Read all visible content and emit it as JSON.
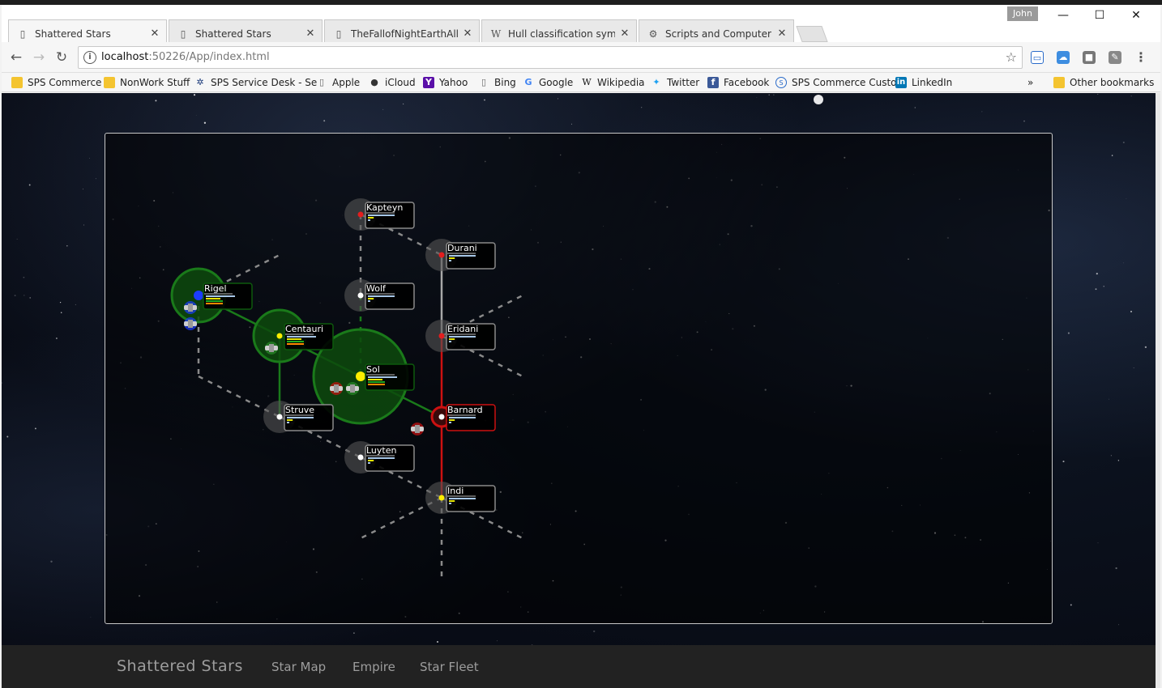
{
  "browser": {
    "tabs": [
      {
        "title": "Shattered Stars",
        "favicon": "page-icon",
        "active": true
      },
      {
        "title": "Shattered Stars",
        "favicon": "page-icon",
        "active": false
      },
      {
        "title": "TheFallofNightEarthAllian",
        "favicon": "page-icon",
        "active": false
      },
      {
        "title": "Hull classification symbo",
        "favicon": "wikipedia-icon",
        "active": false
      },
      {
        "title": "Scripts and Computer Pla",
        "favicon": "gear-icon",
        "active": false
      }
    ],
    "close_glyph": "✕",
    "user_name": "John",
    "window_controls": {
      "minimize": "—",
      "maximize": "☐",
      "close": "✕"
    },
    "address": {
      "host": "localhost",
      "path": ":50226/App/index.html"
    },
    "bookmarks": [
      {
        "label": "SPS Commerce",
        "icon": "folder-icon"
      },
      {
        "label": "NonWork Stuff",
        "icon": "folder-icon"
      },
      {
        "label": "SPS Service Desk - Se",
        "icon": "support-icon"
      },
      {
        "label": "Apple",
        "icon": "page-icon"
      },
      {
        "label": "iCloud",
        "icon": "apple-icon"
      },
      {
        "label": "Yahoo",
        "icon": "yahoo-icon"
      },
      {
        "label": "Bing",
        "icon": "page-icon"
      },
      {
        "label": "Google",
        "icon": "google-icon"
      },
      {
        "label": "Wikipedia",
        "icon": "wikipedia-icon"
      },
      {
        "label": "Twitter",
        "icon": "twitter-icon"
      },
      {
        "label": "Facebook",
        "icon": "facebook-icon"
      },
      {
        "label": "SPS Commerce Custo",
        "icon": "sps-icon"
      },
      {
        "label": "LinkedIn",
        "icon": "linkedin-icon"
      }
    ],
    "bookmarks_overflow": "»",
    "other_bookmarks": "Other bookmarks"
  },
  "app": {
    "brand": "Shattered Stars",
    "nav": [
      {
        "label": "Star Map"
      },
      {
        "label": "Empire"
      },
      {
        "label": "Star Fleet"
      }
    ]
  },
  "star_map": {
    "colors": {
      "friendly": "#1a7a1a",
      "hostile": "#cc1111",
      "neutral": "#555555",
      "lane": "#a8a8a8",
      "bar_blue": "#a7c7e7",
      "bar_yellow": "#e6e600",
      "bar_green": "#22aa22",
      "bar_orange": "#ff8800"
    },
    "systems": [
      {
        "name": "Kapteyn",
        "star": "#e31e1e",
        "owner": "neutral"
      },
      {
        "name": "Durani",
        "star": "#e31e1e",
        "owner": "neutral"
      },
      {
        "name": "Rigel",
        "star": "#1c3cff",
        "owner": "friendly"
      },
      {
        "name": "Wolf",
        "star": "#ffffff",
        "owner": "neutral"
      },
      {
        "name": "Centauri",
        "star": "#ffee00",
        "owner": "friendly"
      },
      {
        "name": "Eridani",
        "star": "#e31e1e",
        "owner": "neutral"
      },
      {
        "name": "Sol",
        "star": "#ffee00",
        "owner": "friendly"
      },
      {
        "name": "Struve",
        "star": "#ffffff",
        "owner": "neutral"
      },
      {
        "name": "Barnard",
        "star": "#ffffff",
        "owner": "hostile"
      },
      {
        "name": "Luyten",
        "star": "#ffffff",
        "owner": "neutral"
      },
      {
        "name": "Indi",
        "star": "#ffee00",
        "owner": "neutral"
      }
    ]
  }
}
